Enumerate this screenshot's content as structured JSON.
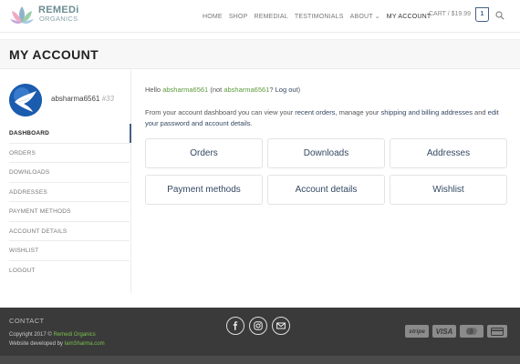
{
  "brand": {
    "line1": "REMEDi",
    "line2": "ORGANICS"
  },
  "nav": {
    "items": [
      {
        "label": "HOME"
      },
      {
        "label": "SHOP"
      },
      {
        "label": "REMEDIAL"
      },
      {
        "label": "TESTIMONIALS"
      },
      {
        "label": "ABOUT ⌄"
      },
      {
        "label": "MY ACCOUNT"
      }
    ],
    "cart_label": "CART / $19.99",
    "cart_count": "1"
  },
  "page": {
    "title": "MY ACCOUNT"
  },
  "sidebar": {
    "username": "absharma6561",
    "user_id": "#33",
    "items": [
      {
        "label": "DASHBOARD"
      },
      {
        "label": "ORDERS"
      },
      {
        "label": "DOWNLOADS"
      },
      {
        "label": "ADDRESSES"
      },
      {
        "label": "PAYMENT METHODS"
      },
      {
        "label": "ACCOUNT DETAILS"
      },
      {
        "label": "WISHLIST"
      },
      {
        "label": "LOGOUT"
      }
    ]
  },
  "main": {
    "hello_prefix": "Hello ",
    "hello_user": "absharma6561",
    "hello_mid": " (not ",
    "hello_user2": "absharma6561",
    "hello_q": "? ",
    "logout": "Log out",
    "hello_end": ")",
    "intro_1": "From your account dashboard you can view your ",
    "recent_orders": "recent orders",
    "intro_2": ", manage your ",
    "addresses_link": "shipping and billing addresses",
    "intro_3": " and ",
    "edit_link": "edit your password and account details",
    "intro_4": ".",
    "tiles": [
      {
        "label": "Orders"
      },
      {
        "label": "Downloads"
      },
      {
        "label": "Addresses"
      },
      {
        "label": "Payment methods"
      },
      {
        "label": "Account details"
      },
      {
        "label": "Wishlist"
      }
    ]
  },
  "footer": {
    "contact": "CONTACT",
    "copyright_prefix": "Copyright 2017 © ",
    "copyright_brand": "Remedi Organics",
    "dev_prefix": "Website developed by ",
    "dev_link": "IamSharma.com",
    "payments": [
      "stripe",
      "VISA",
      "mastercard",
      "card"
    ]
  }
}
